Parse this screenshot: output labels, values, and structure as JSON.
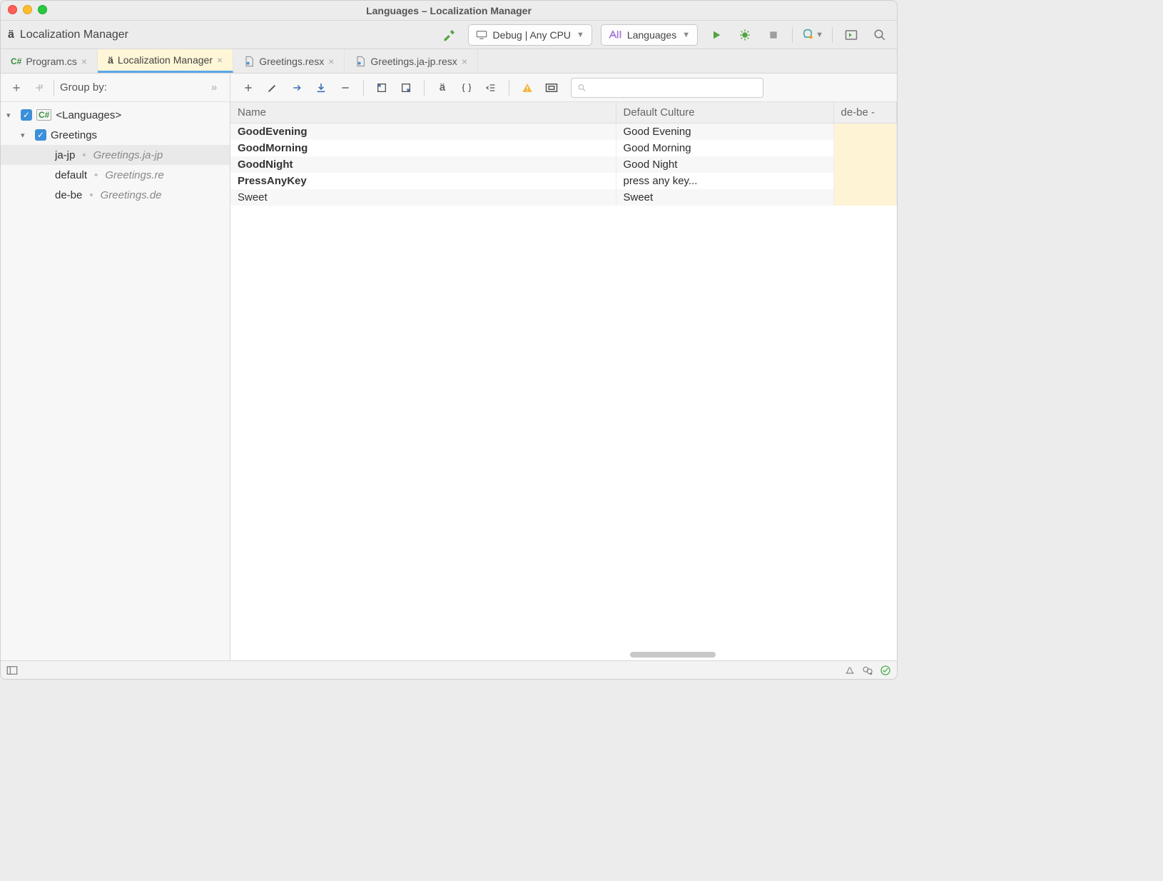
{
  "window": {
    "title": "Languages – Localization Manager"
  },
  "app_title": "Localization Manager",
  "toolbar": {
    "config_label": "Debug | Any CPU",
    "project_label": "Languages"
  },
  "tabs": [
    {
      "label": "Program.cs",
      "kind": "csharp",
      "active": false
    },
    {
      "label": "Localization Manager",
      "kind": "a-umlaut",
      "active": true
    },
    {
      "label": "Greetings.resx",
      "kind": "resx",
      "active": false
    },
    {
      "label": "Greetings.ja-jp.resx",
      "kind": "resx",
      "active": false
    }
  ],
  "sidebar": {
    "group_by_label": "Group by:",
    "tree": {
      "root": {
        "label": "<Languages>"
      },
      "group": {
        "label": "Greetings"
      },
      "leaves": [
        {
          "culture": "ja-jp",
          "file": "Greetings.ja-jp"
        },
        {
          "culture": "default",
          "file": "Greetings.re"
        },
        {
          "culture": "de-be",
          "file": "Greetings.de"
        }
      ]
    }
  },
  "table": {
    "columns": {
      "name": "Name",
      "default": "Default Culture",
      "debe": "de-be -"
    },
    "rows": [
      {
        "name": "GoodEvening",
        "default": "Good Evening",
        "bold": true
      },
      {
        "name": "GoodMorning",
        "default": "Good Morning",
        "bold": true
      },
      {
        "name": "GoodNight",
        "default": "Good Night",
        "bold": true
      },
      {
        "name": "PressAnyKey",
        "default": "press any key...",
        "bold": true
      },
      {
        "name": "Sweet",
        "default": "Sweet",
        "bold": false
      }
    ]
  },
  "search": {
    "placeholder": ""
  }
}
